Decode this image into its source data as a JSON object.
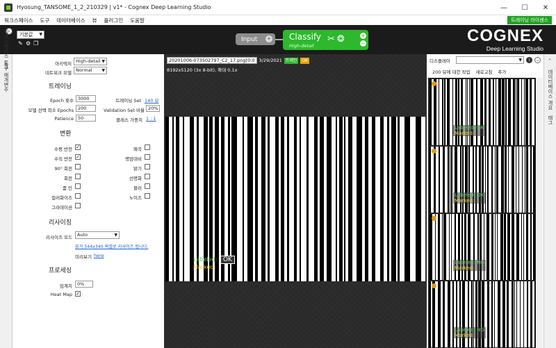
{
  "window": {
    "title": "Hyosung_TANSOME_1_2_210329 | v1* - Cognex Deep Learning Studio",
    "minimize": "—",
    "maximize": "☐",
    "close": "✕"
  },
  "menu": {
    "items": [
      "워크스페이스",
      "도구",
      "데이터베이스",
      "뷰",
      "플러그인",
      "도움말"
    ],
    "license_button": "트레이닝 라이센스"
  },
  "toolbar": {
    "preset": "기본값",
    "input_node": "Input",
    "classify_node": "Classify",
    "classify_mode": "High-detail",
    "logo_main": "COGNEX",
    "logo_sub": "Deep Learning Studio"
  },
  "left_strip": {
    "tools_label": "워크스페이스 도구",
    "params_label": "도구 매개변수"
  },
  "params": {
    "architecture_label": "아키텍처",
    "architecture_value": "High-detail",
    "network_model_label": "네트워크 모델",
    "network_model_value": "Normal",
    "training_section": "트레이닝",
    "epoch_label": "Epoch 횟수",
    "epoch_value": "3000",
    "training_set_label": "트레이닝 Set",
    "training_set_value": "140 뷰",
    "model_select_label": "모델 선택 최소 Epochs",
    "model_select_value": "200",
    "validation_label": "Validation Set 비율",
    "validation_value": "20%",
    "patience_label": "Patience",
    "patience_value": "50",
    "class_weight_label": "클래스 가중치",
    "class_weight_value": "1 : 1",
    "transform_section": "변환",
    "transforms_left": [
      {
        "label": "수평 반전",
        "checked": "✓"
      },
      {
        "label": "수직 반전",
        "checked": "✓"
      },
      {
        "label": "90° 회전",
        "checked": ""
      },
      {
        "label": "회전",
        "checked": ""
      },
      {
        "label": "줌 인",
        "checked": ""
      },
      {
        "label": "컬러화이즈",
        "checked": ""
      },
      {
        "label": "그라데이션",
        "checked": ""
      }
    ],
    "transforms_right": [
      {
        "label": "왜곡",
        "checked": ""
      },
      {
        "label": "명암대비",
        "checked": ""
      },
      {
        "label": "밝기",
        "checked": ""
      },
      {
        "label": "선명화",
        "checked": ""
      },
      {
        "label": "블러",
        "checked": ""
      },
      {
        "label": "노이즈",
        "checked": ""
      }
    ],
    "resize_section": "리사이징",
    "resize_mode_label": "리사이즈 모드",
    "resize_mode_value": "Auto",
    "resize_note": "뷰가 544x340 픽셀로 리사이즈 됩니다.",
    "preview_label": "미리보기",
    "preview_link": "here",
    "processing_section": "프로세싱",
    "threshold_label": "임계치",
    "threshold_value": "0%",
    "heatmap_label": "Heat Map",
    "heatmap_checked": "✓"
  },
  "viewer": {
    "filename": "20201006-073502797_C2_17.png[0:0",
    "date": "3/29/2021",
    "tag_train": "트레인",
    "tag_ok": "OK",
    "dims": "8192x5120 (3x 8-bit), 확대 0.1x",
    "labeled": "Labeled:",
    "labeled_value": "OK",
    "marked": "Marked:"
  },
  "gallery": {
    "display_label": "디스플레이",
    "actions": [
      "200 뷰에 대한 작업",
      "새로고침",
      "추가"
    ],
    "thumbs": [
      {
        "labeled": "Labeled: OK",
        "marked": "Marked:"
      },
      {
        "labeled": "Labeled: OK",
        "marked": "Marked:"
      },
      {
        "labeled": "Labeled: NG",
        "marked": "Marked:"
      },
      {
        "labeled": "Labeled: NG",
        "marked": "Marked:"
      }
    ]
  },
  "right_strip": {
    "label1": "데이터베이스 개요",
    "label2": "태그"
  },
  "colors": {
    "accent_green": "#2db82d",
    "ok_orange": "#e8a200",
    "labeled_green": "#5bd05b",
    "marked_yellow": "#f2d12b",
    "toolbar_bg": "#1b1b1b"
  }
}
